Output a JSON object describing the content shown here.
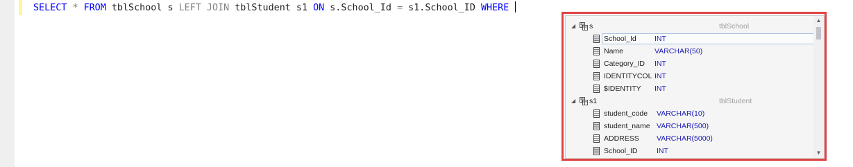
{
  "editor": {
    "tokens": [
      {
        "text": "SELECT",
        "cls": "kw"
      },
      {
        "text": " ",
        "cls": ""
      },
      {
        "text": "*",
        "cls": "gray"
      },
      {
        "text": " ",
        "cls": ""
      },
      {
        "text": "FROM",
        "cls": "kw"
      },
      {
        "text": " tblSchool s ",
        "cls": ""
      },
      {
        "text": "LEFT JOIN",
        "cls": "gray"
      },
      {
        "text": " tblStudent s1 ",
        "cls": ""
      },
      {
        "text": "ON",
        "cls": "kw"
      },
      {
        "text": " s.School_Id ",
        "cls": ""
      },
      {
        "text": "=",
        "cls": "gray"
      },
      {
        "text": " s1.School_ID ",
        "cls": ""
      },
      {
        "text": "WHERE",
        "cls": "kw"
      },
      {
        "text": " ",
        "cls": ""
      }
    ]
  },
  "intellisense": {
    "groups": [
      {
        "alias": "s",
        "table": "tblSchool",
        "columns": [
          {
            "name": "School_Id",
            "type": "INT",
            "selected": true
          },
          {
            "name": "Name",
            "type": "VARCHAR(50)"
          },
          {
            "name": "Category_ID",
            "type": "INT"
          },
          {
            "name": "IDENTITYCOL",
            "type": "INT"
          },
          {
            "name": "$IDENTITY",
            "type": "INT"
          }
        ]
      },
      {
        "alias": "s1",
        "table": "tblStudent",
        "columns": [
          {
            "name": "student_code",
            "type": "VARCHAR(10)"
          },
          {
            "name": "student_name",
            "type": "VARCHAR(500)"
          },
          {
            "name": "ADDRESS",
            "type": "VARCHAR(5000)"
          },
          {
            "name": "School_ID",
            "type": "INT"
          }
        ]
      }
    ],
    "scroll_up_arrow": "▲",
    "scroll_down_arrow": "▼",
    "expand_glyph": "◢",
    "highlight_color": "#e04343"
  }
}
